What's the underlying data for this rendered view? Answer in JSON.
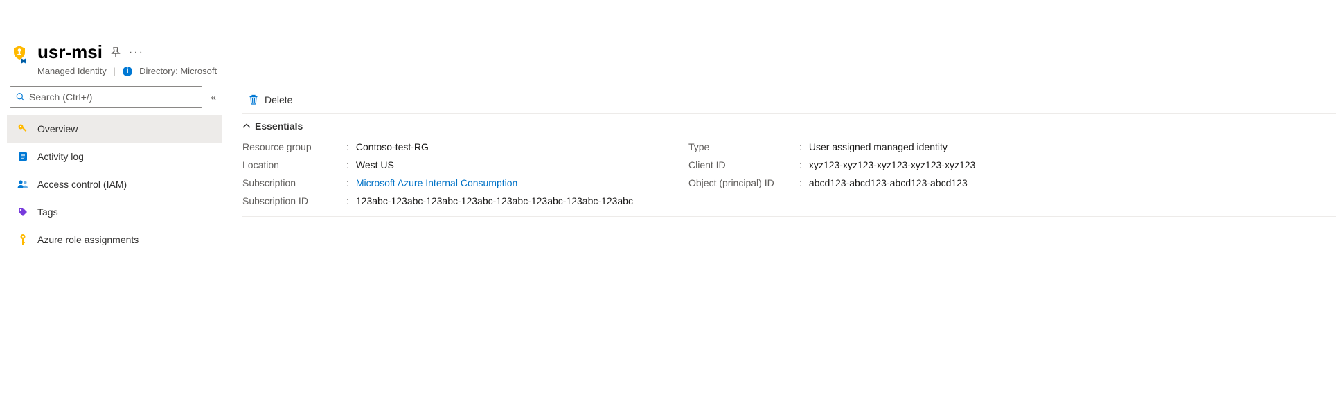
{
  "header": {
    "title": "usr-msi",
    "subtype": "Managed Identity",
    "directory_label": "Directory: Microsoft"
  },
  "sidebar": {
    "search_placeholder": "Search (Ctrl+/)",
    "items": [
      {
        "label": "Overview"
      },
      {
        "label": "Activity log"
      },
      {
        "label": "Access control (IAM)"
      },
      {
        "label": "Tags"
      },
      {
        "label": "Azure role assignments"
      }
    ]
  },
  "commands": {
    "delete_label": "Delete"
  },
  "essentials": {
    "header": "Essentials",
    "left": {
      "resource_group": {
        "label": "Resource group",
        "value": "Contoso-test-RG"
      },
      "location": {
        "label": "Location",
        "value": "West US"
      },
      "subscription": {
        "label": "Subscription",
        "value": "Microsoft Azure Internal Consumption"
      },
      "subscription_id": {
        "label": "Subscription ID",
        "value": "123abc-123abc-123abc-123abc-123abc-123abc-123abc-123abc"
      }
    },
    "right": {
      "type": {
        "label": "Type",
        "value": "User assigned managed identity"
      },
      "client_id": {
        "label": "Client ID",
        "value": "xyz123-xyz123-xyz123-xyz123-xyz123"
      },
      "object_id": {
        "label": "Object (principal) ID",
        "value": "abcd123-abcd123-abcd123-abcd123"
      }
    }
  }
}
